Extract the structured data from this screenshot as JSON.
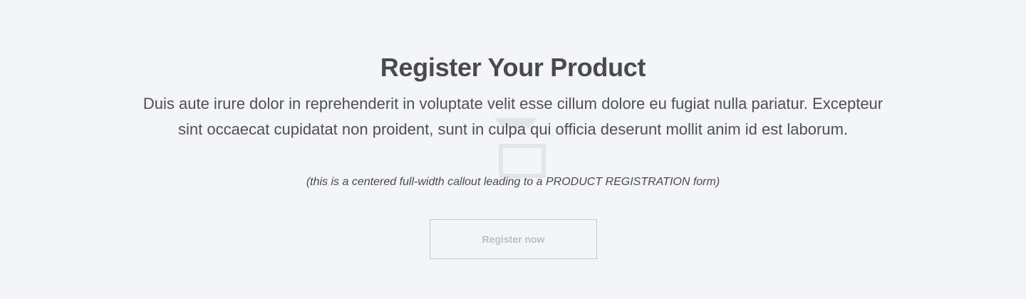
{
  "callout": {
    "title": "Register Your Product",
    "description": "Duis aute irure dolor in reprehenderit in voluptate velit esse cillum dolore eu fugiat nulla pariatur. Excepteur sint occaecat cupidatat non proident, sunt in culpa qui officia deserunt mollit anim id est laborum.",
    "note": "(this is a centered full-width callout leading to a PRODUCT REGISTRATION form)",
    "button_label": "Register now",
    "watermark_icon": "image-placeholder-icon"
  },
  "colors": {
    "background": "#f4f5f9",
    "text": "#4a4a4c",
    "button_border": "#c9c9cc",
    "button_text": "#bdbdc0"
  }
}
